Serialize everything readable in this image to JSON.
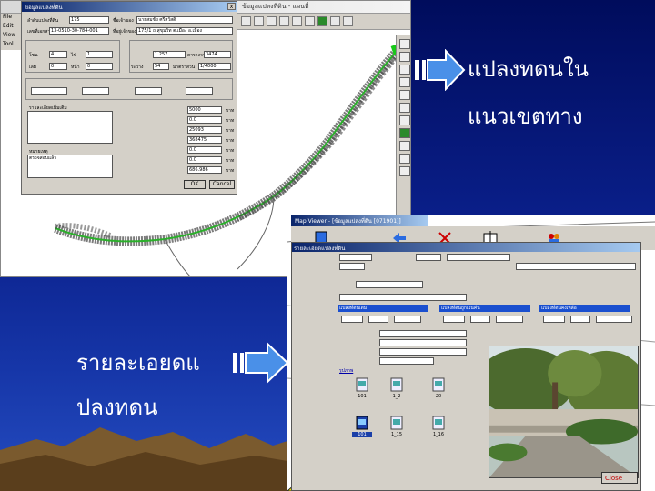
{
  "slide": {
    "caption_top_line1": "แปลงทดนใน",
    "caption_top_line2": "แนวเขตทาง",
    "caption_bottom_line1": "รายละเอยดแ",
    "caption_bottom_line2": "ปลงทดน",
    "text_color": "#ffffff",
    "arrow_color": "#4a90e8"
  },
  "top_window": {
    "title": "ข้อมูลแปลงที่ดิน - แผนที่",
    "menu_items": [
      "File",
      "Edit",
      "View",
      "Tool"
    ],
    "dialog": {
      "title": "ข้อมูลแปลงที่ดิน",
      "close_glyph": "x",
      "fields": {
        "parcel_id_label": "ลำดับแปลงที่ดิน",
        "parcel_id": "175",
        "owner_label": "ชื่อเจ้าของ",
        "owner": "นายสมชัย ศรีสวัสดิ์",
        "doc_label": "เลขที่เอกสาร",
        "doc": "13-0510-30-784-001",
        "address_label": "ที่อยู่เจ้าของ",
        "address": "175/1 ถ.สุขุมวิท ต.เมือง อ.เมือง",
        "rai_label": "ไร่",
        "rai": "1",
        "ngan_label": "งาน",
        "wa_label": "ตารางวา",
        "area_rai": "1.257",
        "area_wa": "3474",
        "sheet_label": "ระวาง",
        "sheet": "54",
        "scale_label": "มาตราส่วน",
        "scale": "1/4000",
        "zone_label": "โซน",
        "zone": "4",
        "book_label": "เล่ม",
        "book": "0",
        "page_label": "หน้า",
        "page": "0",
        "cut_area": "5000",
        "remain_area": "0.0",
        "value_total": "25093",
        "value_pay": "368475",
        "other_1": "0.0",
        "other_2": "0.0",
        "total_value": "686.986",
        "unit": "บาท",
        "note_label": "หมายเหตุ",
        "note": "ตรวจสอบแล้ว",
        "remark_area_label": "รายละเอียดเพิ่มเติม"
      },
      "ok_label": "OK",
      "cancel_label": "Cancel"
    }
  },
  "bottom_window": {
    "title": "Map Viewer - [ข้อมูลแปลงที่ดิน [071901]]",
    "panel_title": "รายละเอียดแปลงที่ดิน",
    "section_land": "แปลงที่ดินเดิม",
    "section_cut": "แปลงที่ดินถูกเวนคืน",
    "section_remain": "แปลงที่ดินคงเหลือ",
    "files_label": "รูปภาพ",
    "file_labels": [
      "101",
      "1_2",
      "20",
      "101",
      "1_15",
      "1_16"
    ],
    "close_label": "Close"
  }
}
